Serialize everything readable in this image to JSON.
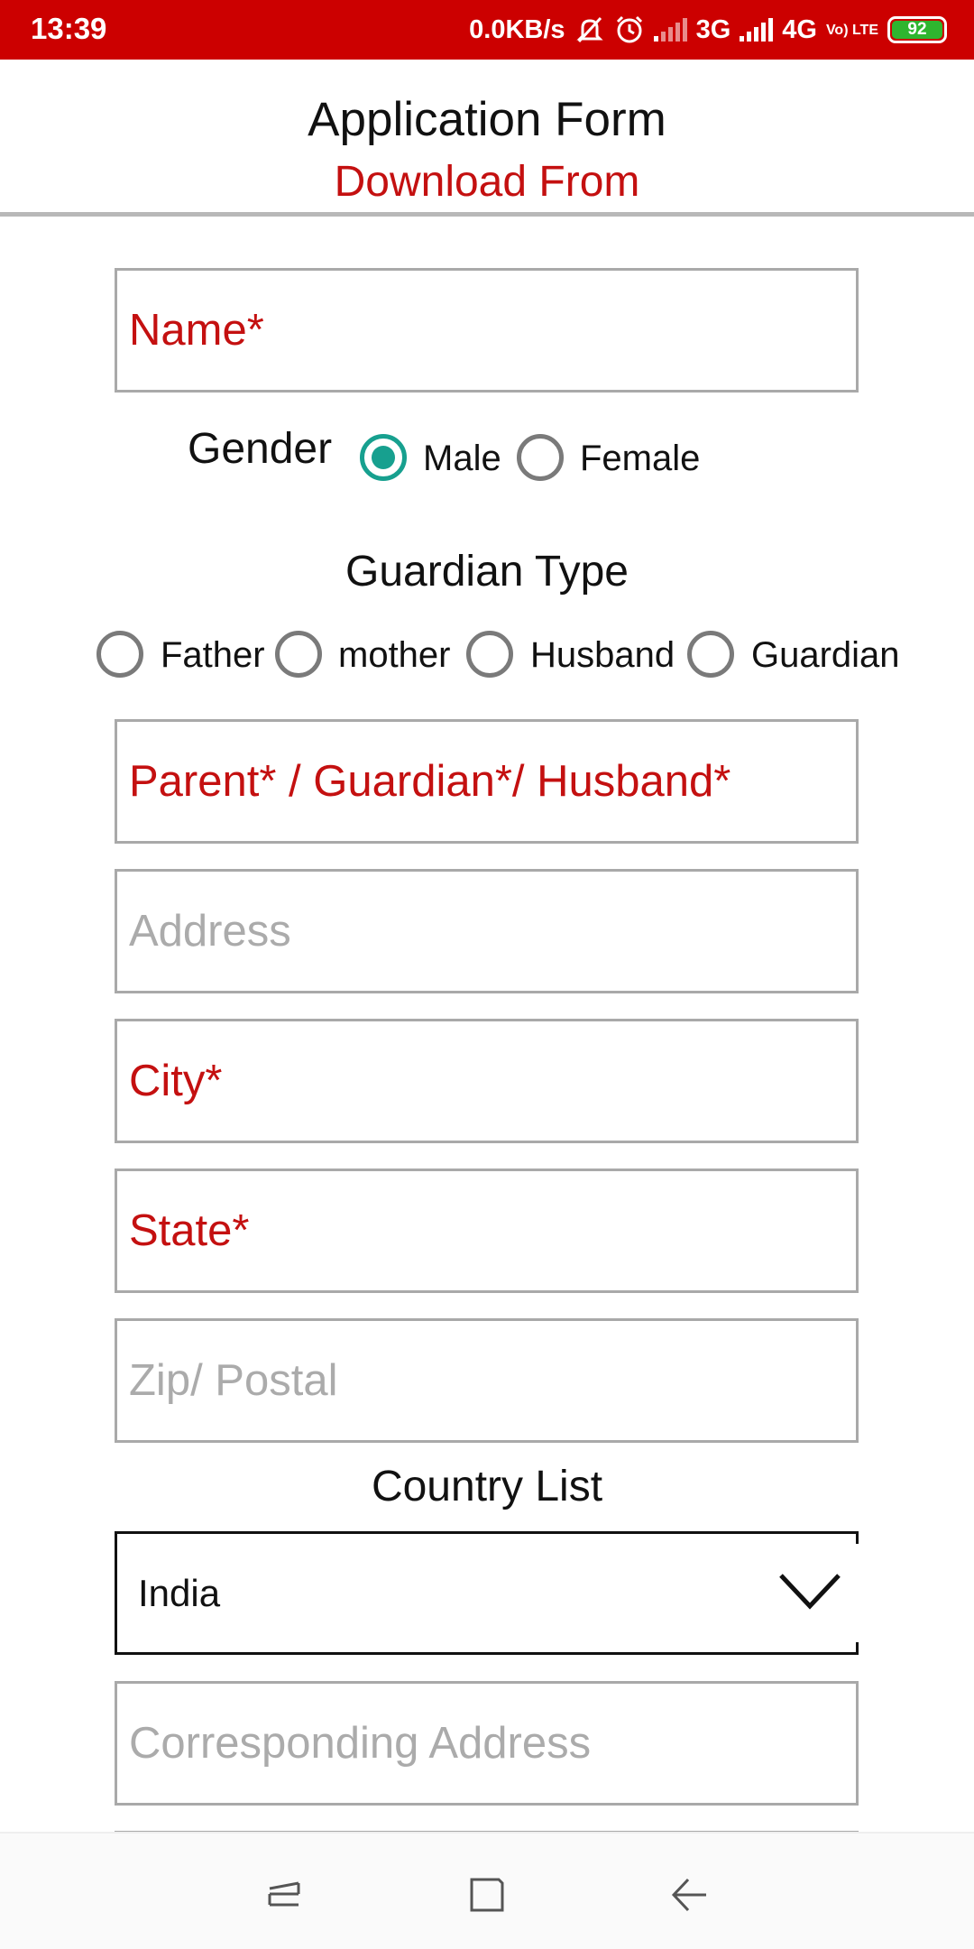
{
  "status_bar": {
    "time": "13:39",
    "net_speed": "0.0KB/s",
    "network_1": "3G",
    "network_2": "4G",
    "volte": "Vo) LTE",
    "battery": "92",
    "colors": {
      "background": "#cc0000",
      "battery": "#2fb52f"
    },
    "icons": [
      "mute-icon",
      "alarm-icon",
      "signal-icon",
      "signal-icon",
      "battery-icon"
    ]
  },
  "header": {
    "title": "Application Form",
    "subtitle": "Download From"
  },
  "form": {
    "name_placeholder": "Name*",
    "gender": {
      "label": "Gender",
      "options": [
        "Male",
        "Female"
      ],
      "selected": "Male"
    },
    "guardian_type": {
      "label": "Guardian Type",
      "options": [
        "Father",
        "mother",
        "Husband",
        "Guardian"
      ],
      "selected": null
    },
    "guardian_placeholder": "Parent* / Guardian*/ Husband*",
    "address_placeholder": "Address",
    "city_placeholder": "City*",
    "state_placeholder": "State*",
    "zip_placeholder": "Zip/ Postal",
    "country": {
      "label": "Country List",
      "selected": "India"
    },
    "corresponding_address_placeholder": "Corresponding Address"
  },
  "colors": {
    "accent_red": "#c41010",
    "radio_selected": "#17a08f",
    "placeholder_gray": "#ababab"
  },
  "navbar": {
    "icons": [
      "recents-icon",
      "home-icon",
      "back-icon"
    ]
  }
}
